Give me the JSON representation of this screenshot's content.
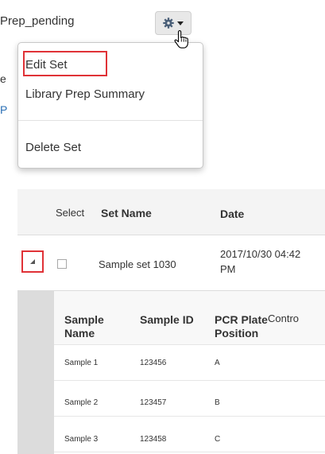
{
  "set_panel": {
    "status_label": "Prep_pending",
    "side_fragments": [
      "e",
      "P"
    ],
    "gear_icon": "gear-icon",
    "menu": {
      "edit_set": "Edit Set",
      "library_prep_summary": "Library Prep Summary",
      "delete_set": "Delete Set"
    },
    "highlight_color": "#e03237"
  },
  "sample_table": {
    "headers": {
      "select": "Select",
      "set_name": "Set Name",
      "date": "Date"
    },
    "set_row": {
      "name": "Sample set 1030",
      "date": "2017/10/30 04:42 PM"
    },
    "nested_headers": [
      "Sample Name",
      "Sample ID",
      "PCR Plate Position",
      "Contro"
    ],
    "samples": [
      {
        "name": "Sample 1",
        "id": "123456",
        "position": "A"
      },
      {
        "name": "Sample 2",
        "id": "123457",
        "position": "B"
      },
      {
        "name": "Sample 3",
        "id": "123458",
        "position": "C"
      }
    ]
  }
}
